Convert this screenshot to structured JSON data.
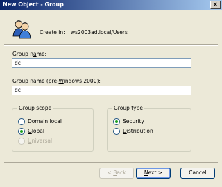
{
  "window": {
    "title": "New Object - Group",
    "close_glyph": "×"
  },
  "header": {
    "icon": "users-group-icon",
    "create_in_label": "Create in:",
    "create_in_path": "ws2003ad.local/Users"
  },
  "group_name": {
    "label_pre": "Group n",
    "label_accel": "a",
    "label_post": "me:",
    "value": "dc"
  },
  "group_name_pre2000": {
    "label_pre": "Group name (pre-",
    "label_accel": "W",
    "label_post": "indows 2000):",
    "value": "dc"
  },
  "group_scope": {
    "legend": "Group scope",
    "options": [
      {
        "accel": "D",
        "rest": "omain local",
        "checked": false,
        "enabled": true
      },
      {
        "accel": "G",
        "rest": "lobal",
        "checked": true,
        "enabled": true
      },
      {
        "accel": "U",
        "rest": "niversal",
        "checked": false,
        "enabled": false
      }
    ]
  },
  "group_type": {
    "legend": "Group type",
    "options": [
      {
        "accel": "S",
        "rest": "ecurity",
        "checked": true,
        "enabled": true
      },
      {
        "accel": "D",
        "rest": "istribution",
        "checked": false,
        "enabled": true
      }
    ]
  },
  "buttons": {
    "back": {
      "pre": "< ",
      "accel": "B",
      "post": "ack",
      "enabled": false
    },
    "next": {
      "accel": "N",
      "post": "ext >",
      "enabled": true
    },
    "cancel": {
      "label": "Cancel",
      "enabled": true
    }
  },
  "colors": {
    "titlebar_start": "#0a246a",
    "titlebar_end": "#a6caf0",
    "dialog_bg": "#ece9d8",
    "radio_dot": "#21a121"
  }
}
